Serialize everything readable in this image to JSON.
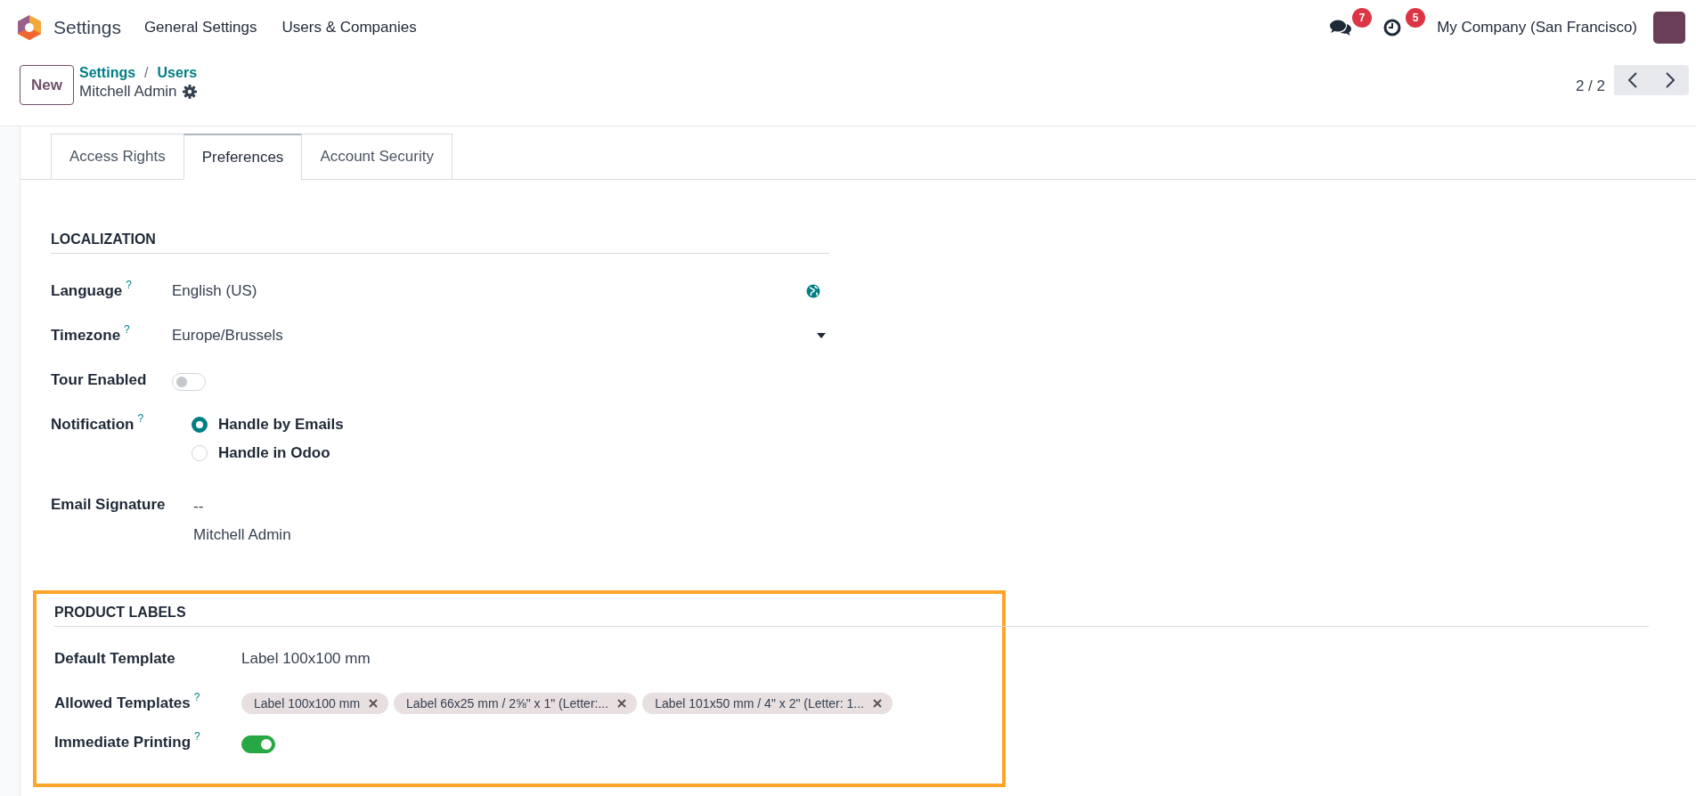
{
  "app": {
    "name": "Settings"
  },
  "nav": [
    "General Settings",
    "Users & Companies"
  ],
  "systray": {
    "messages_count": "7",
    "activities_count": "5",
    "company": "My Company (San Francisco)"
  },
  "control_panel": {
    "new_button": "New",
    "breadcrumb": [
      "Settings",
      "Users"
    ],
    "separator": "/",
    "record": "Mitchell Admin",
    "pager": "2 / 2"
  },
  "tabs": [
    {
      "label": "Access Rights",
      "selected": false
    },
    {
      "label": "Preferences",
      "selected": true
    },
    {
      "label": "Account Security",
      "selected": false
    }
  ],
  "sections": [
    {
      "title": "LOCALIZATION",
      "highlighted": false,
      "wide": false,
      "fields": [
        {
          "kind": "language",
          "label": "Language",
          "help": "?",
          "value": "English (US)"
        },
        {
          "kind": "select",
          "label": "Timezone",
          "help": "?",
          "value": "Europe/Brussels"
        },
        {
          "kind": "toggle",
          "label": "Tour Enabled",
          "on": false
        },
        {
          "kind": "radio",
          "label": "Notification",
          "help": "?",
          "options": [
            {
              "label": "Handle by Emails",
              "selected": true
            },
            {
              "label": "Handle in Odoo",
              "selected": false
            }
          ]
        },
        {
          "kind": "multiline",
          "label": "Email Signature",
          "lines": [
            "--",
            "Mitchell Admin"
          ]
        }
      ]
    },
    {
      "title": "PRODUCT LABELS",
      "highlighted": true,
      "wide": true,
      "fields": [
        {
          "kind": "text",
          "label": "Default Template",
          "value": "Label 100x100 mm"
        },
        {
          "kind": "tags",
          "label": "Allowed Templates",
          "help": "?",
          "tags": [
            "Label 100x100 mm",
            "Label 66x25 mm / 2⅝\" x 1\" (Letter:...",
            "Label 101x50 mm / 4\" x 2\" (Letter: 1..."
          ]
        },
        {
          "kind": "toggle",
          "label": "Immediate Printing",
          "help": "?",
          "on": true
        }
      ]
    }
  ]
}
